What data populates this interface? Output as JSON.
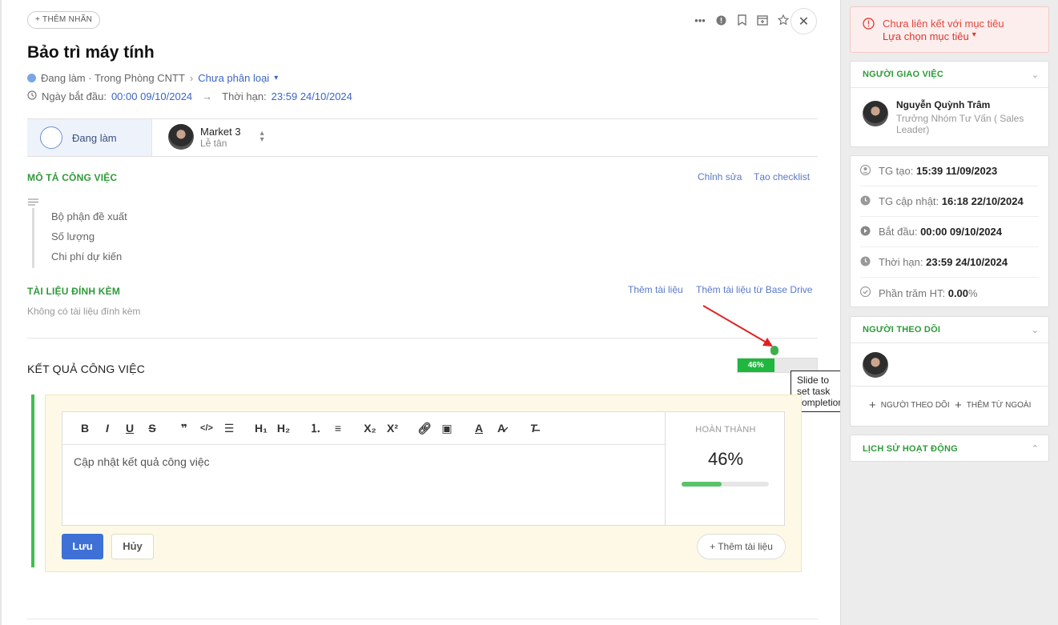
{
  "header": {
    "add_tag_label": "+ THÊM NHÃN",
    "title": "Bảo trì máy tính",
    "status_text": "Đang làm · Trong Phòng CNTT",
    "category_link": "Chưa phân loại",
    "start_label": "Ngày bắt đầu:",
    "start_value": "00:00 09/10/2024",
    "deadline_label": "Thời hạn:",
    "deadline_value": "23:59 24/10/2024"
  },
  "status_bar": {
    "status": "Đang làm",
    "assignee_name": "Market 3",
    "assignee_role": "Lễ tân"
  },
  "description": {
    "title": "MÔ TẢ CÔNG VIỆC",
    "edit_link": "Chỉnh sửa",
    "checklist_link": "Tạo checklist",
    "lines": [
      "Bộ phận đề xuất",
      "Số lượng",
      "Chi phí dự kiến"
    ]
  },
  "attachments": {
    "title": "TÀI LIỆU ĐÍNH KÈM",
    "add_link": "Thêm tài liệu",
    "add_drive_link": "Thêm tài liệu từ Base Drive",
    "empty_text": "Không có tài liệu đính kèm"
  },
  "result": {
    "title": "KẾT QUẢ CÔNG VIỆC",
    "progress_label": "46%",
    "progress_value": 0.46,
    "tooltip": "Slide to set task completion",
    "editor_placeholder": "Cập nhật kết quả công việc",
    "complete_label": "HOÀN THÀNH",
    "complete_value": "46%",
    "save_label": "Lưu",
    "cancel_label": "Hủy",
    "add_doc_label": "+ Thêm tài liệu"
  },
  "sidebar": {
    "goal_alert": "Chưa liên kết với mục tiêu",
    "goal_select": "Lựa chọn mục tiêu",
    "assigner_title": "NGƯỜI GIAO VIỆC",
    "assigner_name": "Nguyễn Quỳnh Trâm",
    "assigner_role": "Trưởng Nhóm Tư Vấn ( Sales Leader)",
    "info": [
      {
        "label": "TG tạo:",
        "value": "15:39 11/09/2023"
      },
      {
        "label": "TG cập nhật:",
        "value": "16:18 22/10/2024"
      },
      {
        "label": "Bắt đầu:",
        "value": "00:00 09/10/2024"
      },
      {
        "label": "Thời hạn:",
        "value": "23:59 24/10/2024"
      },
      {
        "label": "Phần trăm HT:",
        "value": "0.00",
        "suffix": "%"
      }
    ],
    "followers_title": "NGƯỜI THEO DÕI",
    "add_follower": "NGƯỜI THEO DÕI",
    "add_external": "THÊM TỪ NGOÀI",
    "history_title": "LỊCH SỬ HOẠT ĐỘNG"
  },
  "colors": {
    "accent_green": "#2f9a3a",
    "link_blue": "#3b66c4",
    "progress_green": "#1fb73d",
    "alert_red": "#e0473c"
  }
}
